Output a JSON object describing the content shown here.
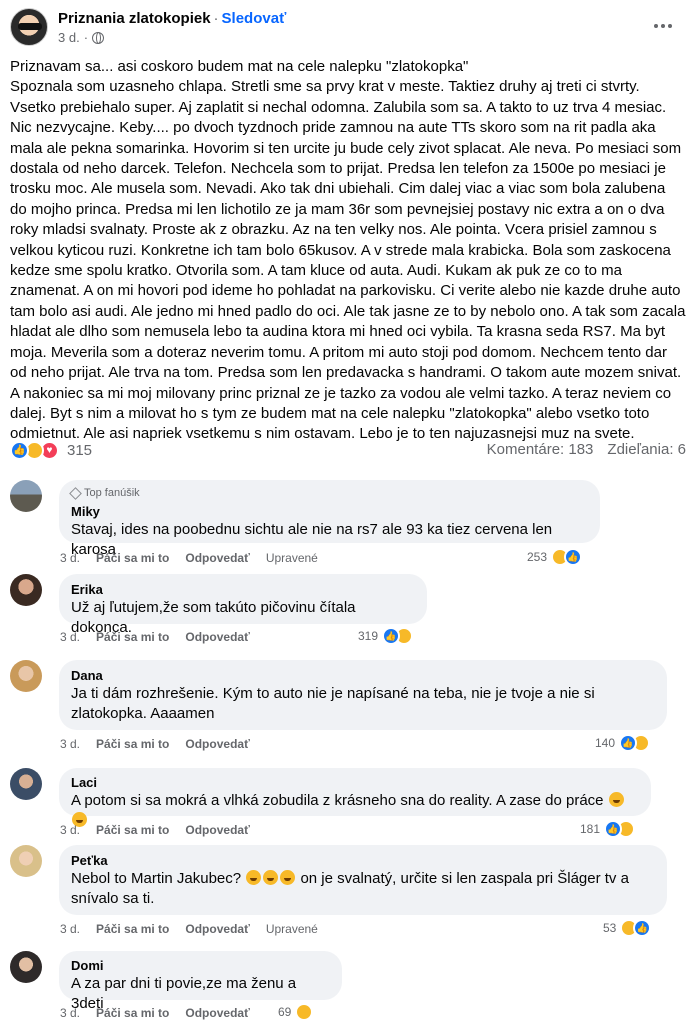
{
  "post": {
    "page_name": "Priznania zlatokopiek",
    "separator": "·",
    "follow_label": "Sledovať",
    "time": "3 d.",
    "meta_dot": "·",
    "title": "Priznavam sa... asi coskoro budem mat na cele nalepku \"zlatokopka\"",
    "text": "Spoznala som uzasneho chlapa. Stretli sme sa prvy krat v meste. Taktiez druhy aj treti ci stvrty. Vsetko prebiehalo super. Aj zaplatit si nechal odomna. Zalubila som sa. A takto to uz trva 4 mesiac. Nic nezvycajne. Keby.... po dvoch tyzdnoch pride zamnou na aute TTs skoro som na rit padla aka mala ale pekna somarinka. Hovorim si ten urcite ju bude cely zivot splacat. Ale neva. Po mesiaci som dostala od neho darcek. Telefon. Nechcela som to prijat. Predsa len telefon za 1500e po mesiaci je trosku moc. Ale musela som. Nevadi. Ako tak dni ubiehali. Cim dalej viac a viac som bola zalubena do mojho princa. Predsa mi len lichotilo ze ja mam 36r som pevnejsiej postavy nic extra a on o dva roky mladsi svalnaty. Proste ak z obrazku. Az na ten velky nos. Ale pointa. Vcera prisiel zamnou s velkou kyticou ruzi. Konkretne ich tam bolo 65kusov. A v strede mala krabicka. Bola som zaskocena kedze sme spolu kratko. Otvorila som. A tam kluce od auta. Audi. Kukam ak puk ze co to ma znamenat. A on mi hovori pod ideme ho pohladat na parkovisku. Ci verite alebo nie kazde druhe auto tam bolo asi audi. Ale jedno mi hned padlo do oci. Ale tak jasne ze to by nebolo ono. A tak som zacala hladat ale dlho som nemusela lebo ta audina ktora mi hned oci vybila. Ta krasna seda RS7. Ma byt moja. Meverila som a doteraz neverim tomu. A pritom mi auto stoji pod domom. Nechcem tento dar od neho prijat. Ale trva na tom. Predsa som len predavacka s handrami. O takom aute mozem snivat. A nakoniec sa mi moj milovany princ priznal ze je tazko za vodou ale velmi tazko. A teraz neviem co dalej. Byt s nim a milovat ho s tym ze budem mat na cele nalepku \"zlatokopka\" alebo vsetko toto odmietnut. Ale asi napriek vsetkemu s nim ostavam. Lebo je to ten najuzasnejsi muz na svete.",
    "reaction_count": "315",
    "comments_label": "Komentáre: 183",
    "shares_label": "Zdieľania: 6"
  },
  "comment_actions": {
    "like": "Páči sa mi to",
    "reply": "Odpovedať",
    "edited": "Upravené"
  },
  "comments": [
    {
      "badge": "Top fanúšik",
      "name": "Miky",
      "text": "Stavaj, ides na poobednu sichtu ale nie na rs7 ale 93 ka tiez cervena len karosa",
      "time": "3 d.",
      "edited": true,
      "reactions": "253"
    },
    {
      "name": "Erika",
      "text": "Už aj ľutujem,že som takúto pičovinu čítala dokonca.",
      "time": "3 d.",
      "edited": false,
      "reactions": "319"
    },
    {
      "name": "Dana",
      "text": "Ja ti dám rozhrešenie. Kým to auto nie je napísané na teba, nie je tvoje a nie si zlatokopka. Aaaamen",
      "time": "3 d.",
      "edited": false,
      "reactions": "140"
    },
    {
      "name": "Laci",
      "text": "A potom si sa mokrá a vlhká zobudila z krásneho sna do reality. A zase do práce",
      "time": "3 d.",
      "edited": false,
      "reactions": "181"
    },
    {
      "name": "Peťka",
      "text_a": "Nebol to Martin Jakubec?",
      "text_b": "on je svalnatý, určite si len zaspala pri Šláger tv a snívalo sa ti.",
      "time": "3 d.",
      "edited": true,
      "reactions": "53"
    },
    {
      "name": "Domi",
      "text": "A za par dni ti povie,ze ma ženu a 3deti",
      "time": "3 d.",
      "edited": false,
      "reactions": "69"
    }
  ],
  "colors": {
    "accent": "#0866ff",
    "bubble": "#f0f2f5",
    "muted": "#65676b",
    "like": "#1877f2",
    "haha": "#f7b928",
    "love": "#f33e58"
  },
  "icons": [
    "globe-icon",
    "more-icon",
    "like-reaction-icon",
    "haha-reaction-icon",
    "love-reaction-icon",
    "top-fan-diamond-icon",
    "emoji-icon"
  ]
}
